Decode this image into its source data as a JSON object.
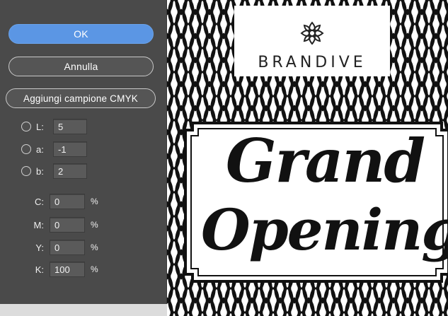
{
  "dialog": {
    "ok_label": "OK",
    "cancel_label": "Annulla",
    "add_swatch_label": "Aggiungi campione CMYK",
    "lab": [
      {
        "label": "L:",
        "value": "5"
      },
      {
        "label": "a:",
        "value": "-1"
      },
      {
        "label": "b:",
        "value": "2"
      }
    ],
    "cmyk": [
      {
        "label": "C:",
        "value": "0",
        "unit": "%"
      },
      {
        "label": "M:",
        "value": "0",
        "unit": "%"
      },
      {
        "label": "Y:",
        "value": "0",
        "unit": "%"
      },
      {
        "label": "K:",
        "value": "100",
        "unit": "%"
      }
    ],
    "colors": {
      "panel": "#4a4a4a",
      "accent": "#5b96e4"
    }
  },
  "artwork": {
    "brand": "BRANDIVE",
    "headline_line1": "Grand",
    "headline_line2": "Opening"
  }
}
